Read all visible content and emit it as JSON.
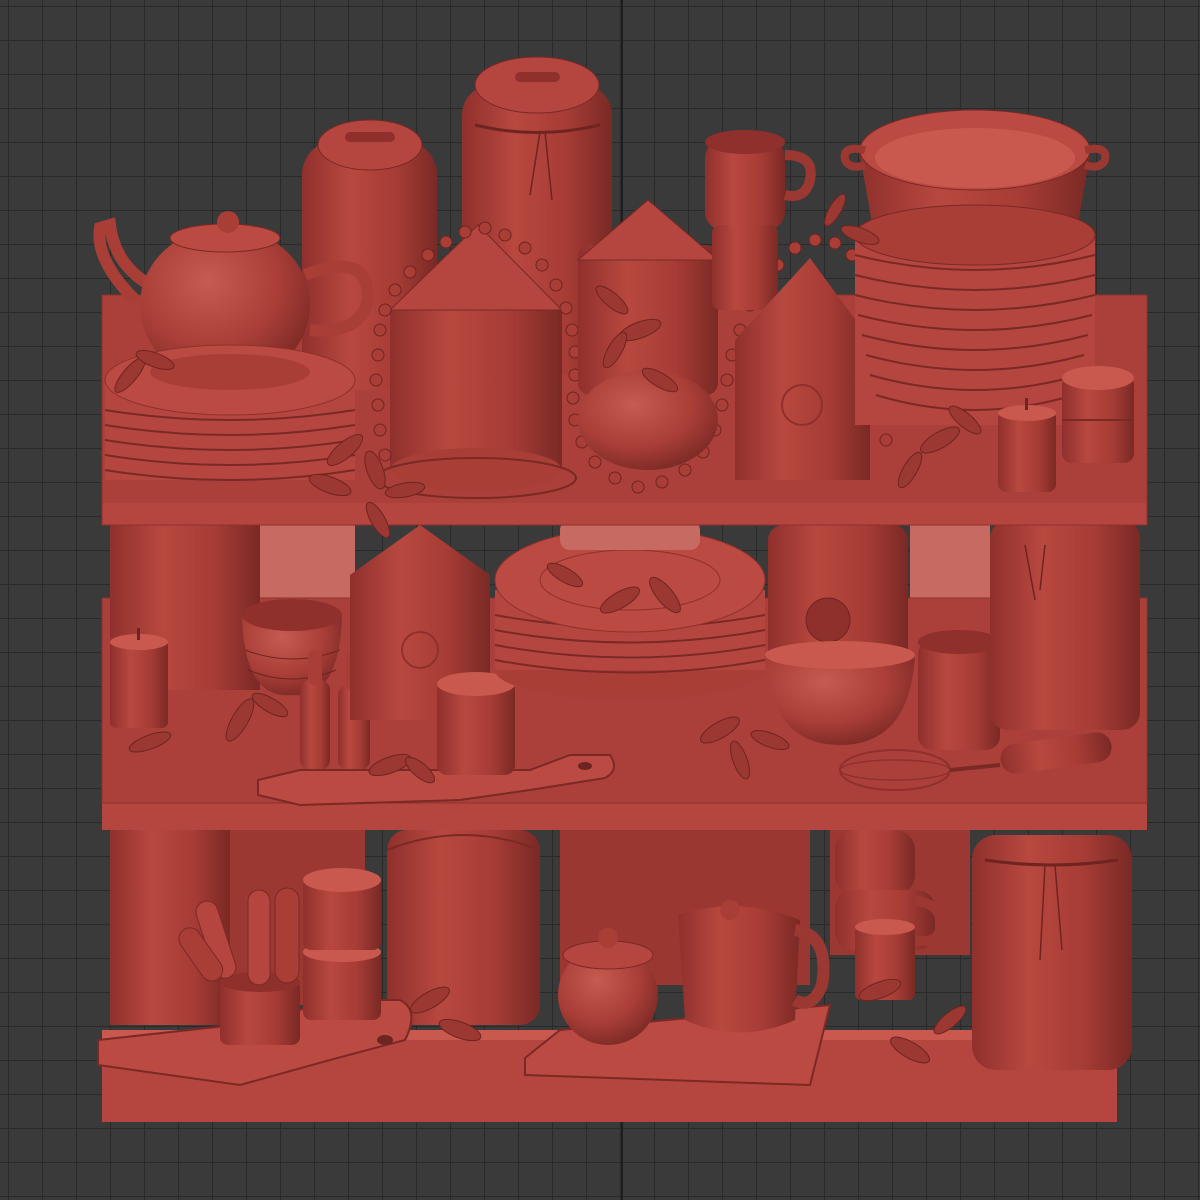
{
  "viewport": {
    "background": "#3a3a3a",
    "grid_color": "#2a2a2a",
    "axis_color": "#1f1f1f"
  },
  "scene": {
    "material_color": "#b5463f",
    "shade_color": "#8f302c",
    "highlight_color": "#c9594f",
    "dark_color": "#6e2420",
    "shelf_count": 3,
    "shelves": [
      {
        "name": "top-shelf",
        "items": [
          "teapot",
          "plate-stack",
          "canister-lidded",
          "canister-twine",
          "cone-box",
          "bead-garland",
          "mug",
          "candle-block",
          "birdhouse",
          "pan",
          "plate-stack-tall",
          "candle",
          "jar-small"
        ]
      },
      {
        "name": "middle-shelf",
        "items": [
          "canister-back",
          "candle",
          "bowl-stack",
          "bottles",
          "birdhouse",
          "plate-stack",
          "birdhouse-round",
          "bowl",
          "cup",
          "mug-small",
          "cutting-board",
          "whisk",
          "canister-twine"
        ]
      },
      {
        "name": "bottom-shelf",
        "items": [
          "canister-back",
          "utensil-holder",
          "jar-stack",
          "canister",
          "cutting-board",
          "sugar-bowl",
          "mug",
          "cup-stack",
          "candle",
          "canister-twine"
        ]
      }
    ]
  }
}
